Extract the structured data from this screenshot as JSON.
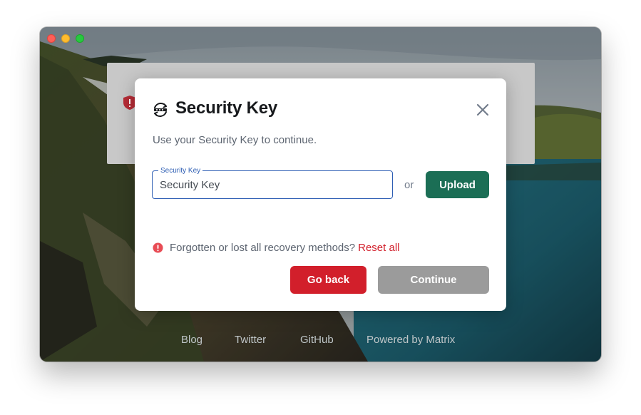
{
  "dialog": {
    "title": "Security Key",
    "description": "Use your Security Key to continue.",
    "field_label": "Security Key",
    "field_placeholder": "Security Key",
    "field_value": "",
    "or_text": "or",
    "upload_label": "Upload",
    "warning_text": "Forgotten or lost all recovery methods?",
    "reset_link": "Reset all",
    "back_label": "Go back",
    "continue_label": "Continue"
  },
  "footer": {
    "links": [
      "Blog",
      "Twitter",
      "GitHub",
      "Powered by Matrix"
    ]
  },
  "colors": {
    "primary": "#1b6e55",
    "danger": "#d21f2b",
    "disabled": "#9b9b9b",
    "focus": "#2f5fb4"
  },
  "icons": {
    "dialog_icon": "security-key-icon",
    "close": "close-icon",
    "warning": "warning-icon",
    "background_shield": "shield-icon"
  }
}
